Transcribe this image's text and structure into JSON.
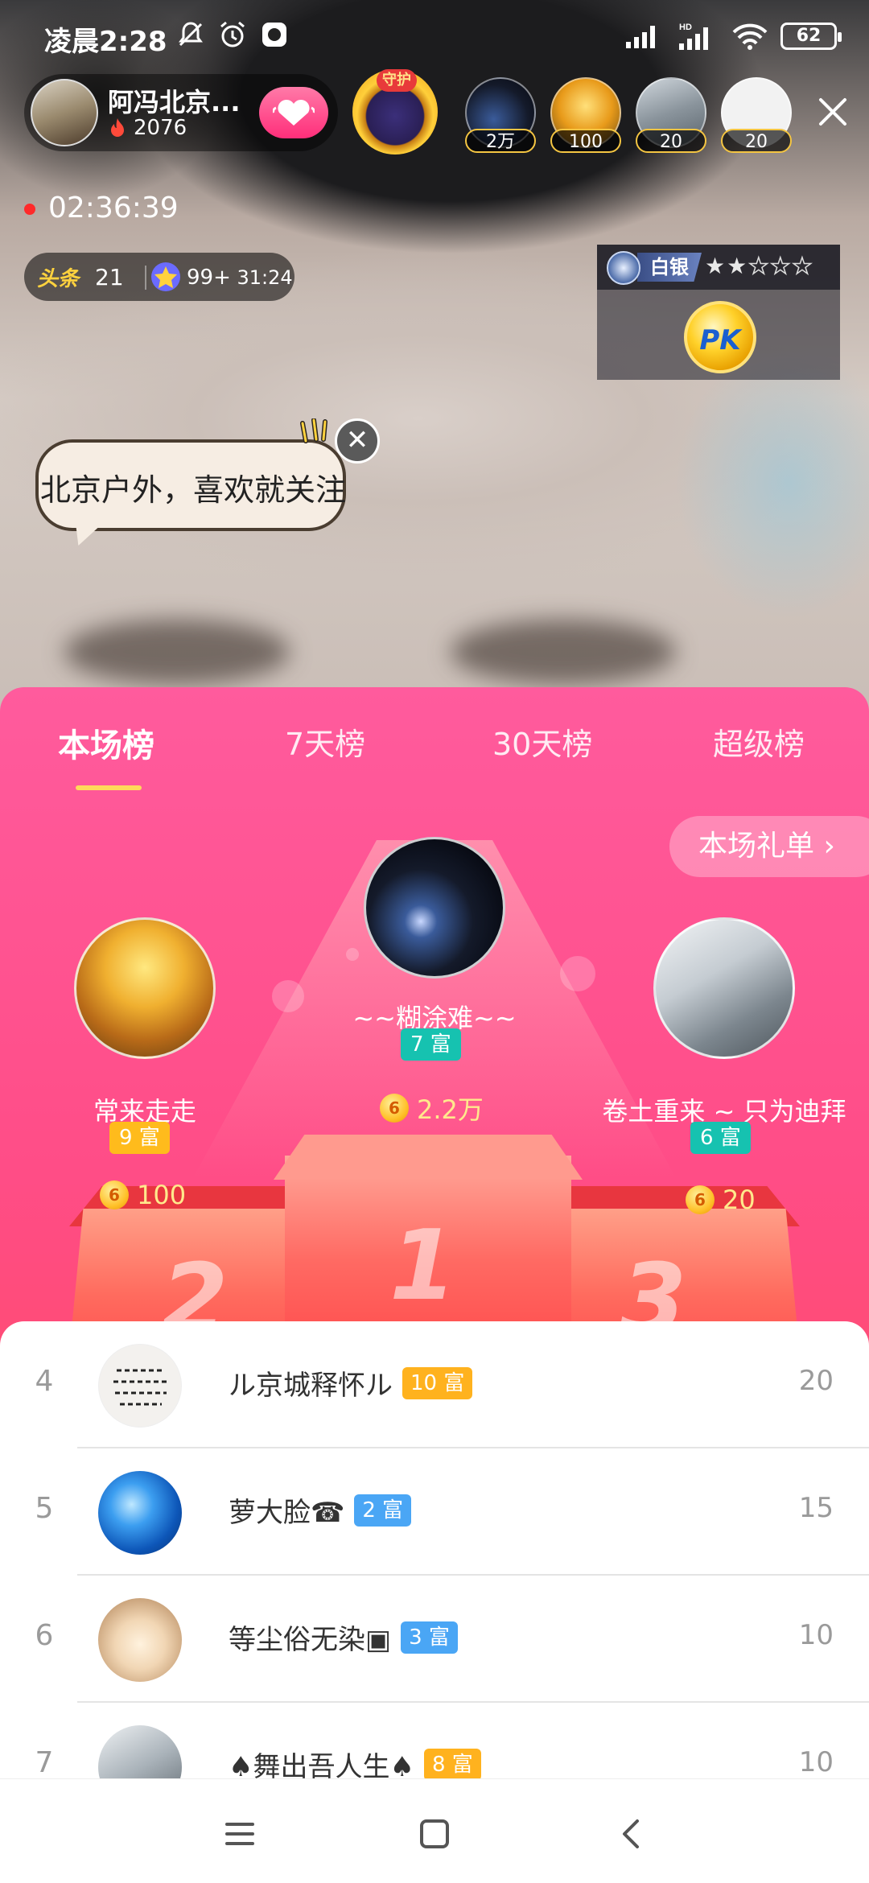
{
  "status_bar": {
    "time": "凌晨2:28",
    "battery": "62",
    "icons": [
      "mute-icon",
      "alarm-icon",
      "app-icon",
      "signal-icon",
      "hd-signal-icon",
      "wifi-icon",
      "battery-icon"
    ]
  },
  "anchor": {
    "name": "阿冯北京...",
    "heat": "2076"
  },
  "top_viewers": [
    {
      "count": "2万"
    },
    {
      "count": "100"
    },
    {
      "count": "20"
    },
    {
      "count": "20"
    }
  ],
  "guard_label": "守护",
  "live_timer": "02:36:39",
  "tags": {
    "toutiao_label": "头条",
    "toutiao_value": "21",
    "star_value": "99+",
    "star_time": "31:24"
  },
  "pk": {
    "rank": "白银",
    "stars_filled": 2,
    "stars_total": 5,
    "button": "PK"
  },
  "bubble_text": "北京户外，喜欢就关注",
  "tabs": [
    {
      "label": "本场榜",
      "active": true
    },
    {
      "label": "7天榜",
      "active": false
    },
    {
      "label": "30天榜",
      "active": false
    },
    {
      "label": "超级榜",
      "active": false
    }
  ],
  "gift_list_button": "本场礼单 ›",
  "top3": [
    {
      "rank": 1,
      "name": "~~糊涂难~~",
      "wealth": "7 富",
      "value": "2.2万"
    },
    {
      "rank": 2,
      "name": "常来走走",
      "wealth": "9 富",
      "value": "100"
    },
    {
      "rank": 3,
      "name": "卷土重来 ~ 只为迪拜",
      "wealth": "6 富",
      "value": "20"
    }
  ],
  "podium_numbers": {
    "first": "1",
    "second": "2",
    "third": "3"
  },
  "coin_symbol": "6",
  "list": [
    {
      "rank": "4",
      "name": "ル京城释怀ル",
      "wealth": "10 富",
      "value": "20"
    },
    {
      "rank": "5",
      "name": "萝大脸☎",
      "wealth": "2 富",
      "value": "15"
    },
    {
      "rank": "6",
      "name": "等尘俗无染▣",
      "wealth": "3 富",
      "value": "10"
    },
    {
      "rank": "7",
      "name": "♠舞出吾人生♠",
      "wealth": "8 富",
      "value": "10"
    }
  ],
  "colors": {
    "sheet_pink": "#ff5b9d",
    "sheet_red": "#ff4d58",
    "wealth_gold": "#ffbb1c",
    "wealth_teal": "#16c2b0",
    "wealth_blue": "#4aa6f5",
    "tab_underline": "#ffd95a"
  }
}
